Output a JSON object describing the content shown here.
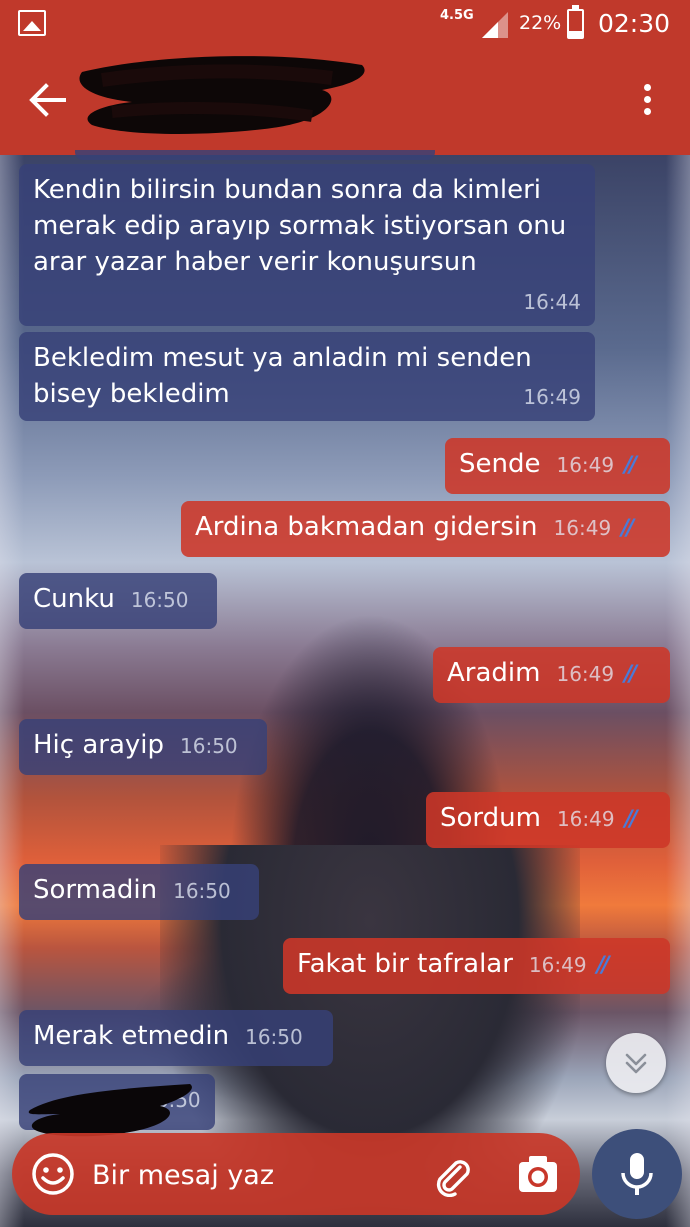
{
  "status_bar": {
    "network": "4.5G",
    "battery_percent_text": "22%",
    "battery_level": 0.22,
    "time": "02:30"
  },
  "header": {
    "back_icon": "arrow-left-icon",
    "menu_icon": "more-vert-icon"
  },
  "messages": [
    {
      "direction": "in",
      "text": "Kendin bilirsin bundan sonra da kimleri merak edip arayıp sormak istiyorsan onu arar yazar haber verir konuşursun",
      "time": "16:44"
    },
    {
      "direction": "in",
      "text": "Bekledim mesut ya anladin mi senden bisey bekledim",
      "time": "16:49"
    },
    {
      "direction": "out",
      "text": "Sende",
      "time": "16:49",
      "ticks": "//"
    },
    {
      "direction": "out",
      "text": "Ardina bakmadan gidersin",
      "time": "16:49",
      "ticks": "//"
    },
    {
      "direction": "in",
      "text": "Cunku",
      "time": "16:50"
    },
    {
      "direction": "out",
      "text": "Aradim",
      "time": "16:49",
      "ticks": "//"
    },
    {
      "direction": "in",
      "text": "Hiç arayip",
      "time": "16:50"
    },
    {
      "direction": "out",
      "text": "Sordum",
      "time": "16:49",
      "ticks": "//"
    },
    {
      "direction": "in",
      "text": "Sormadin",
      "time": "16:50"
    },
    {
      "direction": "out",
      "text": "Fakat bir tafralar",
      "time": "16:49",
      "ticks": "//"
    },
    {
      "direction": "in",
      "text": "Merak etmedin",
      "time": "16:50"
    },
    {
      "direction": "in",
      "text": "",
      "time": "16:50"
    }
  ],
  "composer": {
    "placeholder": "Bir mesaj yaz",
    "emoji_icon": "emoji-icon",
    "attach_icon": "paperclip-icon",
    "camera_icon": "camera-icon",
    "mic_icon": "microphone-icon"
  },
  "scroll_button_icon": "chevrons-down-icon",
  "colors": {
    "header": "#c0392b",
    "incoming_bubble": "#37417a",
    "outgoing_bubble": "#cd3728",
    "read_ticks": "#4a7bd8"
  }
}
